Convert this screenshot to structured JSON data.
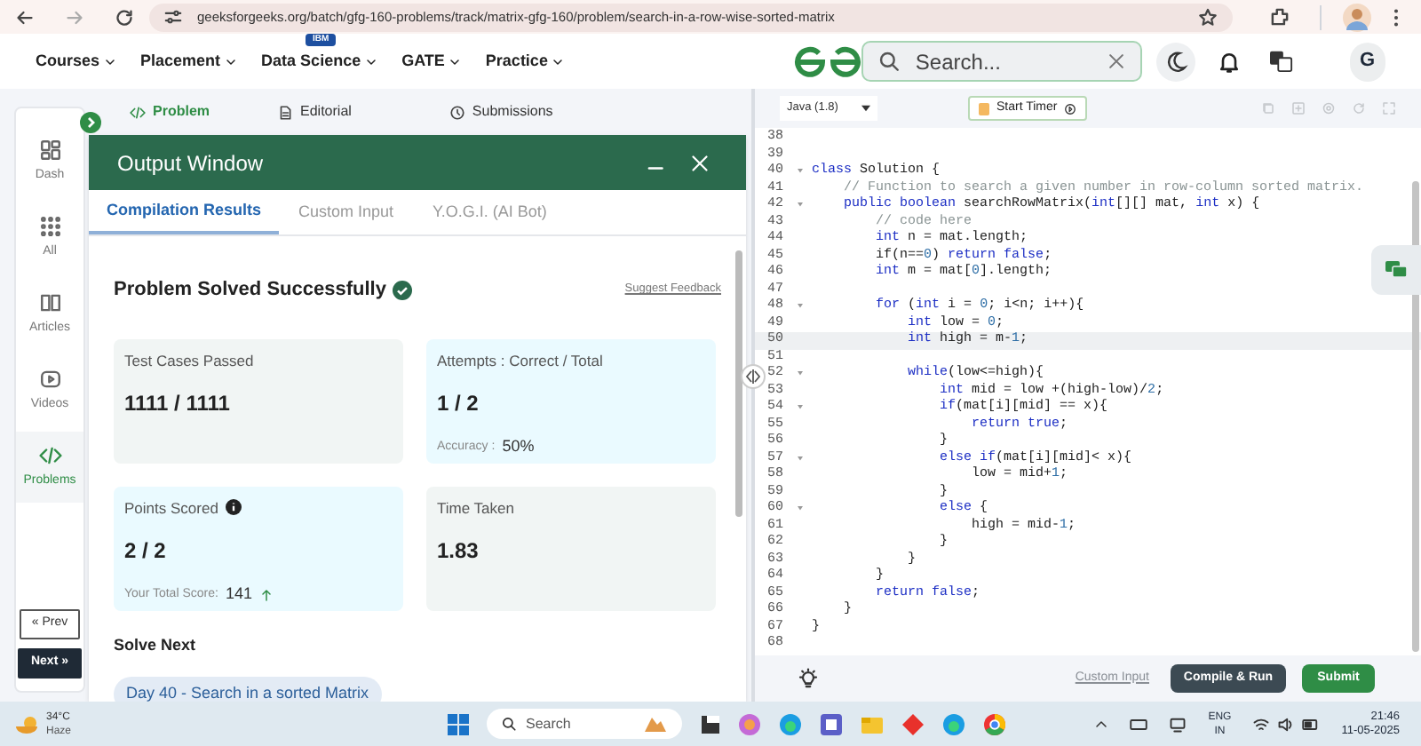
{
  "browser": {
    "url": "geeksforgeeks.org/batch/gfg-160-problems/track/matrix-gfg-160/problem/search-in-a-row-wise-sorted-matrix"
  },
  "site_nav": {
    "menus": [
      {
        "label": "Courses"
      },
      {
        "label": "Placement"
      },
      {
        "badge": "IBM",
        "label": "Data Science"
      },
      {
        "label": "GATE"
      },
      {
        "label": "Practice"
      }
    ],
    "search": {
      "placeholder": "Search..."
    },
    "avatar": "G"
  },
  "sidebar": {
    "items": [
      {
        "label": "Dash",
        "selected": false
      },
      {
        "label": "All",
        "selected": false
      },
      {
        "label": "Articles",
        "selected": false
      },
      {
        "label": "Videos",
        "selected": false
      },
      {
        "label": "Problems",
        "selected": true
      }
    ],
    "prev": "« Prev",
    "next": "Next »"
  },
  "problem_tabs": [
    {
      "label": "Problem",
      "selected": true
    },
    {
      "label": "Editorial",
      "selected": false
    },
    {
      "label": "Submissions",
      "selected": false
    }
  ],
  "output_window": {
    "title": "Output Window",
    "tabs": [
      {
        "label": "Compilation Results",
        "selected": true
      },
      {
        "label": "Custom Input",
        "selected": false
      },
      {
        "label": "Y.O.G.I. (AI Bot)",
        "selected": false
      }
    ],
    "status": "Problem Solved Successfully",
    "feedback_link": "Suggest Feedback",
    "cards": [
      {
        "label": "Test Cases Passed",
        "value": "1111 / 1111",
        "color": "#f1f5f4"
      },
      {
        "label": "Attempts : Correct / Total",
        "value": "1 / 2",
        "note_label": "Accuracy :",
        "note_value": "50%",
        "color": "#eafaff"
      },
      {
        "label": "Points Scored",
        "info": true,
        "value": "2 / 2",
        "note_label": "Your Total Score:",
        "note_value": "141",
        "rising": true,
        "color": "#eafaff"
      },
      {
        "label": "Time Taken",
        "value": "1.83",
        "color": "#f1f5f4"
      }
    ],
    "solve_next": {
      "heading": "Solve Next",
      "items": [
        "Day 40 - Search in a sorted Matrix"
      ]
    }
  },
  "editor": {
    "language": "Java (1.8)",
    "timer_button": "Start Timer",
    "lines": [
      {
        "number": "38"
      },
      {
        "number": "39"
      },
      {
        "number": "40",
        "fold": true,
        "code": [
          {
            "kind": "keyword",
            "text": "class"
          },
          {
            "kind": "plain",
            "text": " Solution {"
          }
        ]
      },
      {
        "number": "41",
        "code": [
          {
            "kind": "comment",
            "text": "    // Function to search a given number in row-column sorted matrix."
          }
        ]
      },
      {
        "number": "42",
        "fold": true,
        "code": [
          {
            "kind": "keyword",
            "text": "    public boolean"
          },
          {
            "kind": "plain",
            "text": " searchRowMatrix("
          },
          {
            "kind": "keyword",
            "text": "int"
          },
          {
            "kind": "plain",
            "text": "[][] mat, "
          },
          {
            "kind": "keyword",
            "text": "int"
          },
          {
            "kind": "plain",
            "text": " x) {"
          }
        ]
      },
      {
        "number": "43",
        "code": [
          {
            "kind": "comment",
            "text": "        // code here"
          }
        ]
      },
      {
        "number": "44",
        "code": [
          {
            "kind": "keyword",
            "text": "        int"
          },
          {
            "kind": "plain",
            "text": " n = mat.length;"
          }
        ]
      },
      {
        "number": "45",
        "code": [
          {
            "kind": "plain",
            "text": "        if(n=="
          },
          {
            "kind": "number",
            "text": "0"
          },
          {
            "kind": "plain",
            "text": ") "
          },
          {
            "kind": "keyword",
            "text": "return false"
          },
          {
            "kind": "plain",
            "text": ";"
          }
        ]
      },
      {
        "number": "46",
        "code": [
          {
            "kind": "keyword",
            "text": "        int"
          },
          {
            "kind": "plain",
            "text": " m = mat["
          },
          {
            "kind": "number",
            "text": "0"
          },
          {
            "kind": "plain",
            "text": "].length;"
          }
        ]
      },
      {
        "number": "47"
      },
      {
        "number": "48",
        "fold": true,
        "code": [
          {
            "kind": "keyword",
            "text": "        for"
          },
          {
            "kind": "plain",
            "text": " ("
          },
          {
            "kind": "keyword",
            "text": "int"
          },
          {
            "kind": "plain",
            "text": " i = "
          },
          {
            "kind": "number",
            "text": "0"
          },
          {
            "kind": "plain",
            "text": "; i<n; i++){"
          }
        ]
      },
      {
        "number": "49",
        "code": [
          {
            "kind": "keyword",
            "text": "            int"
          },
          {
            "kind": "plain",
            "text": " low = "
          },
          {
            "kind": "number",
            "text": "0"
          },
          {
            "kind": "plain",
            "text": ";"
          }
        ]
      },
      {
        "number": "50",
        "current": true,
        "code": [
          {
            "kind": "keyword",
            "text": "            int"
          },
          {
            "kind": "plain",
            "text": " high = m-"
          },
          {
            "kind": "number",
            "text": "1"
          },
          {
            "kind": "plain",
            "text": ";"
          }
        ]
      },
      {
        "number": "51"
      },
      {
        "number": "52",
        "fold": true,
        "code": [
          {
            "kind": "keyword",
            "text": "            while"
          },
          {
            "kind": "plain",
            "text": "(low<=high){"
          }
        ]
      },
      {
        "number": "53",
        "code": [
          {
            "kind": "keyword",
            "text": "                int"
          },
          {
            "kind": "plain",
            "text": " mid = low +(high-low)/"
          },
          {
            "kind": "number",
            "text": "2"
          },
          {
            "kind": "plain",
            "text": ";"
          }
        ]
      },
      {
        "number": "54",
        "fold": true,
        "code": [
          {
            "kind": "keyword",
            "text": "                if"
          },
          {
            "kind": "plain",
            "text": "(mat[i][mid] == x){"
          }
        ]
      },
      {
        "number": "55",
        "code": [
          {
            "kind": "keyword",
            "text": "                    return true"
          },
          {
            "kind": "plain",
            "text": ";"
          }
        ]
      },
      {
        "number": "56",
        "code": [
          {
            "kind": "plain",
            "text": "                }"
          }
        ]
      },
      {
        "number": "57",
        "fold": true,
        "code": [
          {
            "kind": "keyword",
            "text": "                else if"
          },
          {
            "kind": "plain",
            "text": "(mat[i][mid]< x){"
          }
        ]
      },
      {
        "number": "58",
        "code": [
          {
            "kind": "plain",
            "text": "                    low = mid+"
          },
          {
            "kind": "number",
            "text": "1"
          },
          {
            "kind": "plain",
            "text": ";"
          }
        ]
      },
      {
        "number": "59",
        "code": [
          {
            "kind": "plain",
            "text": "                }"
          }
        ]
      },
      {
        "number": "60",
        "fold": true,
        "code": [
          {
            "kind": "keyword",
            "text": "                else"
          },
          {
            "kind": "plain",
            "text": " {"
          }
        ]
      },
      {
        "number": "61",
        "code": [
          {
            "kind": "plain",
            "text": "                    high = mid-"
          },
          {
            "kind": "number",
            "text": "1"
          },
          {
            "kind": "plain",
            "text": ";"
          }
        ]
      },
      {
        "number": "62",
        "code": [
          {
            "kind": "plain",
            "text": "                }"
          }
        ]
      },
      {
        "number": "63",
        "code": [
          {
            "kind": "plain",
            "text": "            }"
          }
        ]
      },
      {
        "number": "64",
        "code": [
          {
            "kind": "plain",
            "text": "        }"
          }
        ]
      },
      {
        "number": "65",
        "code": [
          {
            "kind": "keyword",
            "text": "        return false"
          },
          {
            "kind": "plain",
            "text": ";"
          }
        ]
      },
      {
        "number": "66",
        "code": [
          {
            "kind": "plain",
            "text": "    }"
          }
        ]
      },
      {
        "number": "67",
        "code": [
          {
            "kind": "plain",
            "text": "}"
          }
        ]
      },
      {
        "number": "68"
      }
    ],
    "custom_input_link": "Custom Input",
    "compile_button": "Compile & Run",
    "submit_button": "Submit"
  },
  "taskbar": {
    "weather": {
      "temp": "34°C",
      "condition": "Haze"
    },
    "search": {
      "placeholder": "Search"
    },
    "language": {
      "line1": "ENG",
      "line2": "IN"
    },
    "time": "21:46",
    "date": "11-05-2025"
  }
}
